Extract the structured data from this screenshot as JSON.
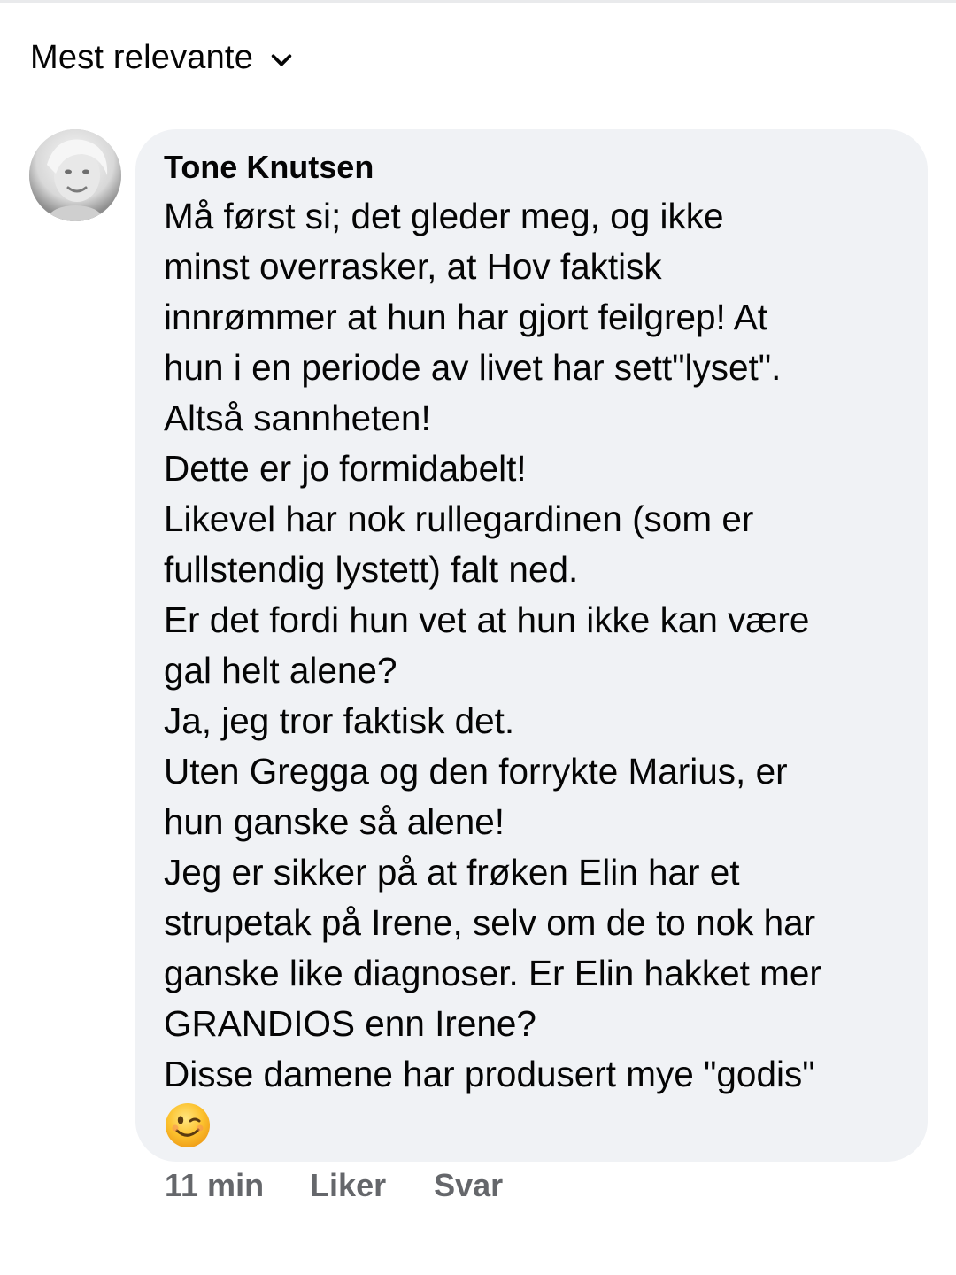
{
  "sort": {
    "label": "Mest relevante",
    "icon": "chevron-down-icon"
  },
  "comment": {
    "author": "Tone Knutsen",
    "avatar_icon": "profile-photo",
    "lines": [
      "Må først si; det gleder meg, og ikke",
      "minst overrasker, at Hov faktisk",
      "innrømmer at hun har gjort feilgrep! At",
      "hun i en periode av livet har sett\"lyset\".",
      "Altså sannheten!",
      "Dette er jo formidabelt!",
      "Likevel har nok rullegardinen (som er",
      "fullstendig lystett) falt ned.",
      "Er det fordi hun vet at hun ikke kan være",
      "gal helt alene?",
      "Ja, jeg tror faktisk det.",
      "Uten Gregga og den forrykte Marius, er",
      "hun ganske så alene!",
      "Jeg er sikker på at frøken Elin har et",
      "strupetak på Irene, selv om de to nok har",
      "ganske like diagnoser. Er Elin hakket mer",
      "GRANDIOS enn Irene?",
      "Disse damene har produsert mye \"godis\""
    ],
    "emoji": "winking-face-emoji",
    "time": "11 min",
    "like_label": "Liker",
    "reply_label": "Svar"
  },
  "colors": {
    "bubble_bg": "#f0f2f5",
    "text": "#050505",
    "secondary_text": "#65676b",
    "emoji_yellow": "#fbc02d"
  }
}
